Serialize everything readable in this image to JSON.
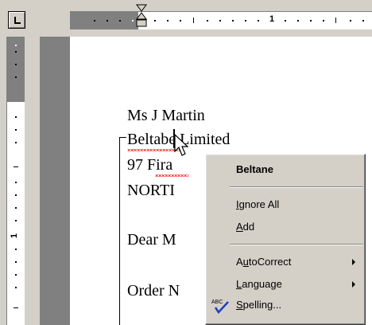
{
  "rulers": {
    "horizontal_number": "1",
    "vertical_number": "1"
  },
  "document": {
    "lines": [
      {
        "text": "Ms J Martin",
        "id": "line-1"
      },
      {
        "text": "Beltabe Limited",
        "id": "line-2"
      },
      {
        "text": "97 Fira",
        "id": "line-3"
      },
      {
        "text": "NORTI",
        "id": "line-4"
      },
      {
        "text": "Dear M",
        "id": "line-5"
      },
      {
        "text": "Order N",
        "id": "line-6"
      }
    ],
    "misspelled_word": "Beltabe"
  },
  "context_menu": {
    "suggestion": "Beltane",
    "ignore_all": {
      "pre": "",
      "key": "I",
      "post": "gnore All"
    },
    "add": {
      "pre": "",
      "key": "A",
      "post": "dd"
    },
    "autocorrect": {
      "pre": "A",
      "key": "u",
      "post": "toCorrect"
    },
    "language": {
      "pre": "",
      "key": "L",
      "post": "anguage"
    },
    "spelling": {
      "pre": "",
      "key": "S",
      "post": "pelling..."
    },
    "spelling_icon_text": "ABC"
  },
  "colors": {
    "chrome": "#d4d0c8",
    "page_shadow": "#808080",
    "squiggle": "#ff0000"
  },
  "icons": [
    "tab-selector-icon",
    "indent-marker-icon",
    "pointer-cursor-icon",
    "submenu-arrow-icon",
    "spelling-check-icon"
  ]
}
